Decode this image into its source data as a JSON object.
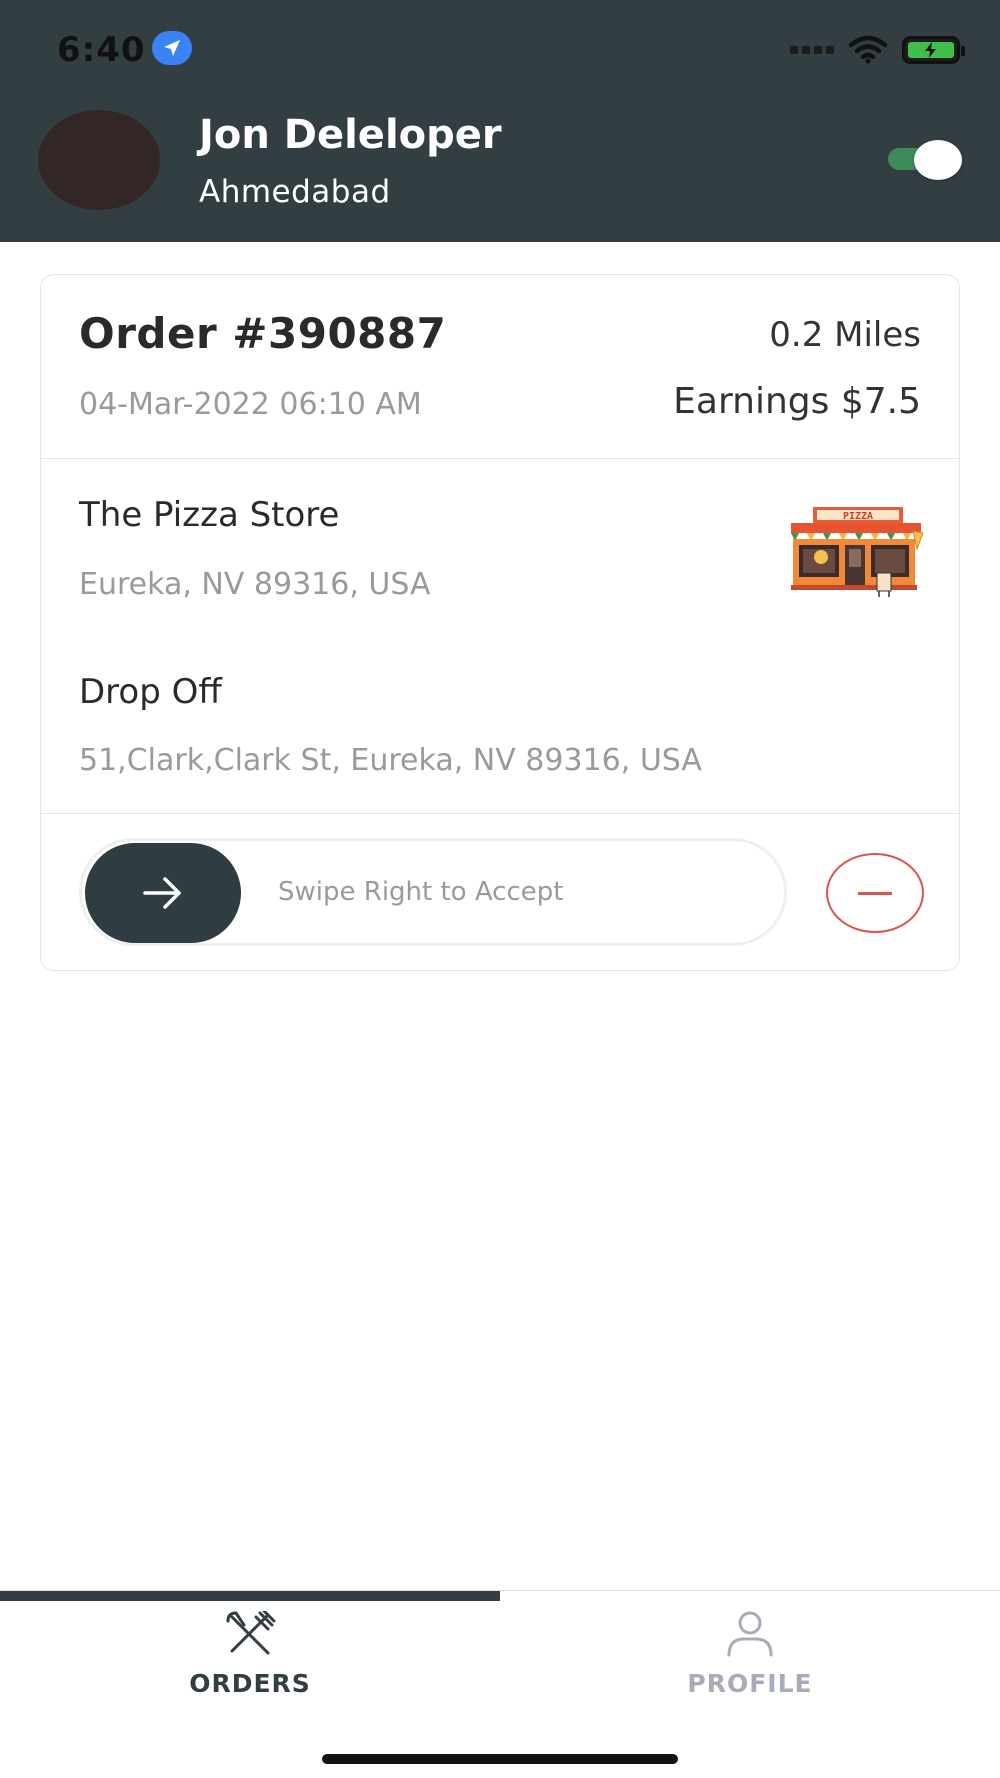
{
  "status_bar": {
    "time": "6:40"
  },
  "header": {
    "user_name": "Jon Deleloper",
    "city": "Ahmedabad",
    "online_toggle": "on"
  },
  "order": {
    "title": "Order #390887",
    "date": "04-Mar-2022 06:10 AM",
    "distance": "0.2 Miles",
    "earnings": "Earnings $7.5",
    "pickup": {
      "name": "The Pizza Store",
      "address": "Eureka, NV 89316, USA",
      "sign_text": "PIZZA"
    },
    "dropoff": {
      "title": "Drop Off",
      "address": "51,Clark,Clark St, Eureka, NV 89316, USA"
    },
    "swipe_label": "Swipe Right to Accept"
  },
  "tabs": [
    {
      "label": "ORDERS",
      "icon": "fork-knife-icon",
      "active": true
    },
    {
      "label": "PROFILE",
      "icon": "person-icon",
      "active": false
    }
  ],
  "colors": {
    "header_bg": "#333e43",
    "toggle_on": "#3f8a58",
    "reject": "#d8554d",
    "muted_text": "#9a9a9a"
  }
}
